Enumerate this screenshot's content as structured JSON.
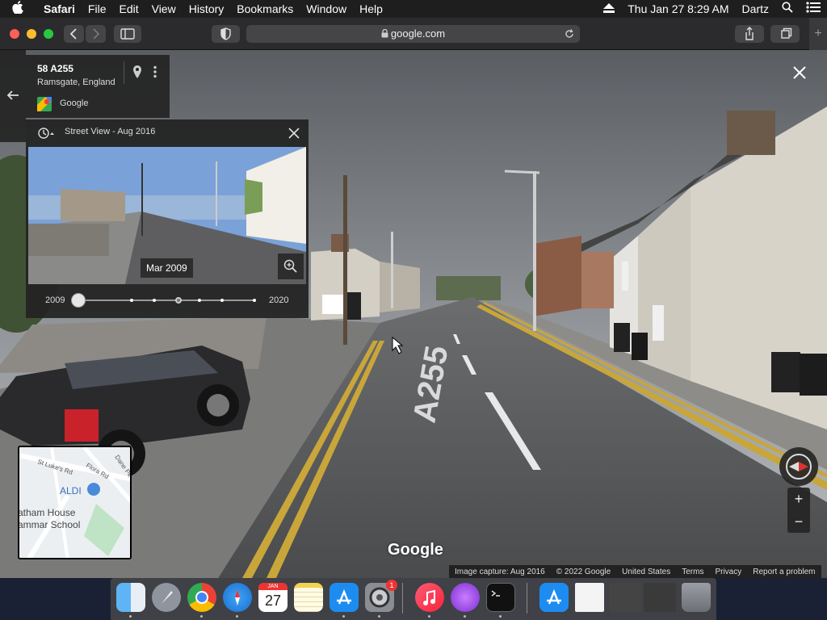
{
  "menubar": {
    "app_name": "Safari",
    "items": [
      "File",
      "Edit",
      "View",
      "History",
      "Bookmarks",
      "Window",
      "Help"
    ],
    "datetime": "Thu Jan 27  8:29 AM",
    "user": "Dartz"
  },
  "browser": {
    "url": "google.com",
    "new_tab_label": "+"
  },
  "place": {
    "title": "58 A255",
    "subtitle": "Ramsgate, England",
    "provider": "Google"
  },
  "timeline": {
    "title": "Street View - Aug 2016",
    "selected_date": "Mar 2009",
    "year_start": "2009",
    "year_end": "2020"
  },
  "minimap": {
    "labels": [
      "St Luke's Rd",
      "Flora Rd",
      "Dane Pk",
      "ALDI",
      "atham House",
      "ammar School"
    ]
  },
  "watermark": "Google",
  "footer": {
    "capture": "Image capture: Aug 2016",
    "copyright": "© 2022 Google",
    "region": "United States",
    "terms": "Terms",
    "privacy": "Privacy",
    "report": "Report a problem"
  },
  "road_marking": "A255",
  "dock": {
    "calendar_month": "JAN",
    "calendar_day": "27",
    "settings_badge": "1"
  },
  "colors": {
    "menubar_bg": "#1e1e1e",
    "toolbar_bg": "#2b2b2d",
    "panel_bg": "#242424",
    "dock_bg": "#46464b"
  }
}
